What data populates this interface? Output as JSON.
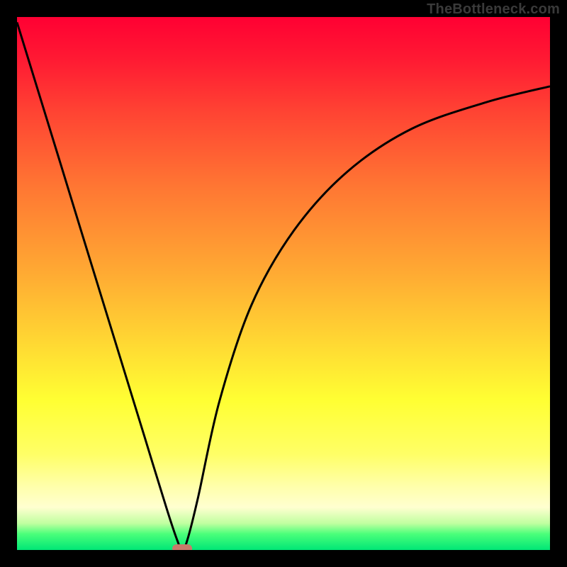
{
  "watermark": {
    "text": "TheBottleneck.com"
  },
  "chart_data": {
    "type": "line",
    "title": "",
    "xlabel": "",
    "ylabel": "",
    "xlim": [
      0,
      100
    ],
    "ylim": [
      0,
      100
    ],
    "grid": false,
    "legend": false,
    "series": [
      {
        "name": "bottleneck-curve",
        "x": [
          0,
          4,
          8,
          12,
          16,
          20,
          24,
          28,
          30,
          31,
          32,
          34,
          38,
          44,
          52,
          62,
          74,
          88,
          100
        ],
        "y": [
          99,
          86,
          73,
          60,
          47,
          34,
          21,
          8,
          2,
          0,
          2,
          10,
          28,
          46,
          60,
          71,
          79,
          84,
          87
        ]
      }
    ],
    "annotations": [
      {
        "name": "min-marker",
        "x": 31,
        "y": 0,
        "shape": "pill",
        "color": "#c97a6a"
      }
    ],
    "background": {
      "type": "vertical-gradient",
      "stops": [
        {
          "pos": 0.0,
          "color": "#ff0033"
        },
        {
          "pos": 0.5,
          "color": "#ffaa33"
        },
        {
          "pos": 0.75,
          "color": "#ffff33"
        },
        {
          "pos": 0.95,
          "color": "#c0ffa0"
        },
        {
          "pos": 1.0,
          "color": "#00e676"
        }
      ]
    }
  }
}
